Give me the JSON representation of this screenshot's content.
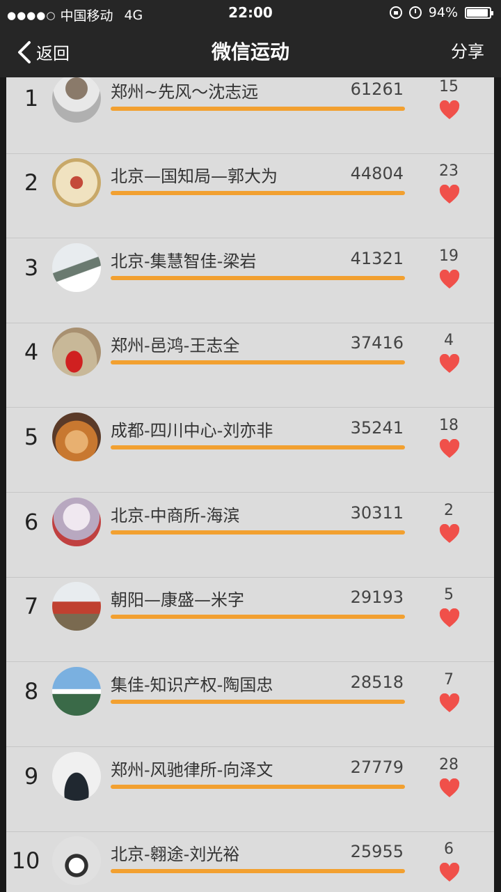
{
  "status_bar": {
    "signal": "●●●●○",
    "carrier": "中国移动",
    "network": "4G",
    "time": "22:00",
    "battery_text": "94%",
    "battery_level": 0.94
  },
  "nav": {
    "back_label": "返回",
    "title": "微信运动",
    "share_label": "分享"
  },
  "colors": {
    "bar": "#f2a030",
    "heart": "#f0504a",
    "nav_bg": "#262626",
    "list_bg": "#dcdcdc"
  },
  "rows": [
    {
      "rank": "1",
      "name": "郑州~先风～沈志远",
      "steps": "61261",
      "likes": "15"
    },
    {
      "rank": "2",
      "name": "北京—国知局—郭大为",
      "steps": "44804",
      "likes": "23"
    },
    {
      "rank": "3",
      "name": "北京-集慧智佳-梁岩",
      "steps": "41321",
      "likes": "19"
    },
    {
      "rank": "4",
      "name": "郑州-邑鸿-王志全",
      "steps": "37416",
      "likes": "4"
    },
    {
      "rank": "5",
      "name": "成都-四川中心-刘亦非",
      "steps": "35241",
      "likes": "18"
    },
    {
      "rank": "6",
      "name": "北京-中商所-海滨",
      "steps": "30311",
      "likes": "2"
    },
    {
      "rank": "7",
      "name": "朝阳—康盛—米字",
      "steps": "29193",
      "likes": "5"
    },
    {
      "rank": "8",
      "name": "集佳-知识产权-陶国忠",
      "steps": "28518",
      "likes": "7"
    },
    {
      "rank": "9",
      "name": "郑州-风驰律所-向泽文",
      "steps": "27779",
      "likes": "28"
    },
    {
      "rank": "10",
      "name": "北京-翱途-刘光裕",
      "steps": "25955",
      "likes": "6"
    }
  ]
}
